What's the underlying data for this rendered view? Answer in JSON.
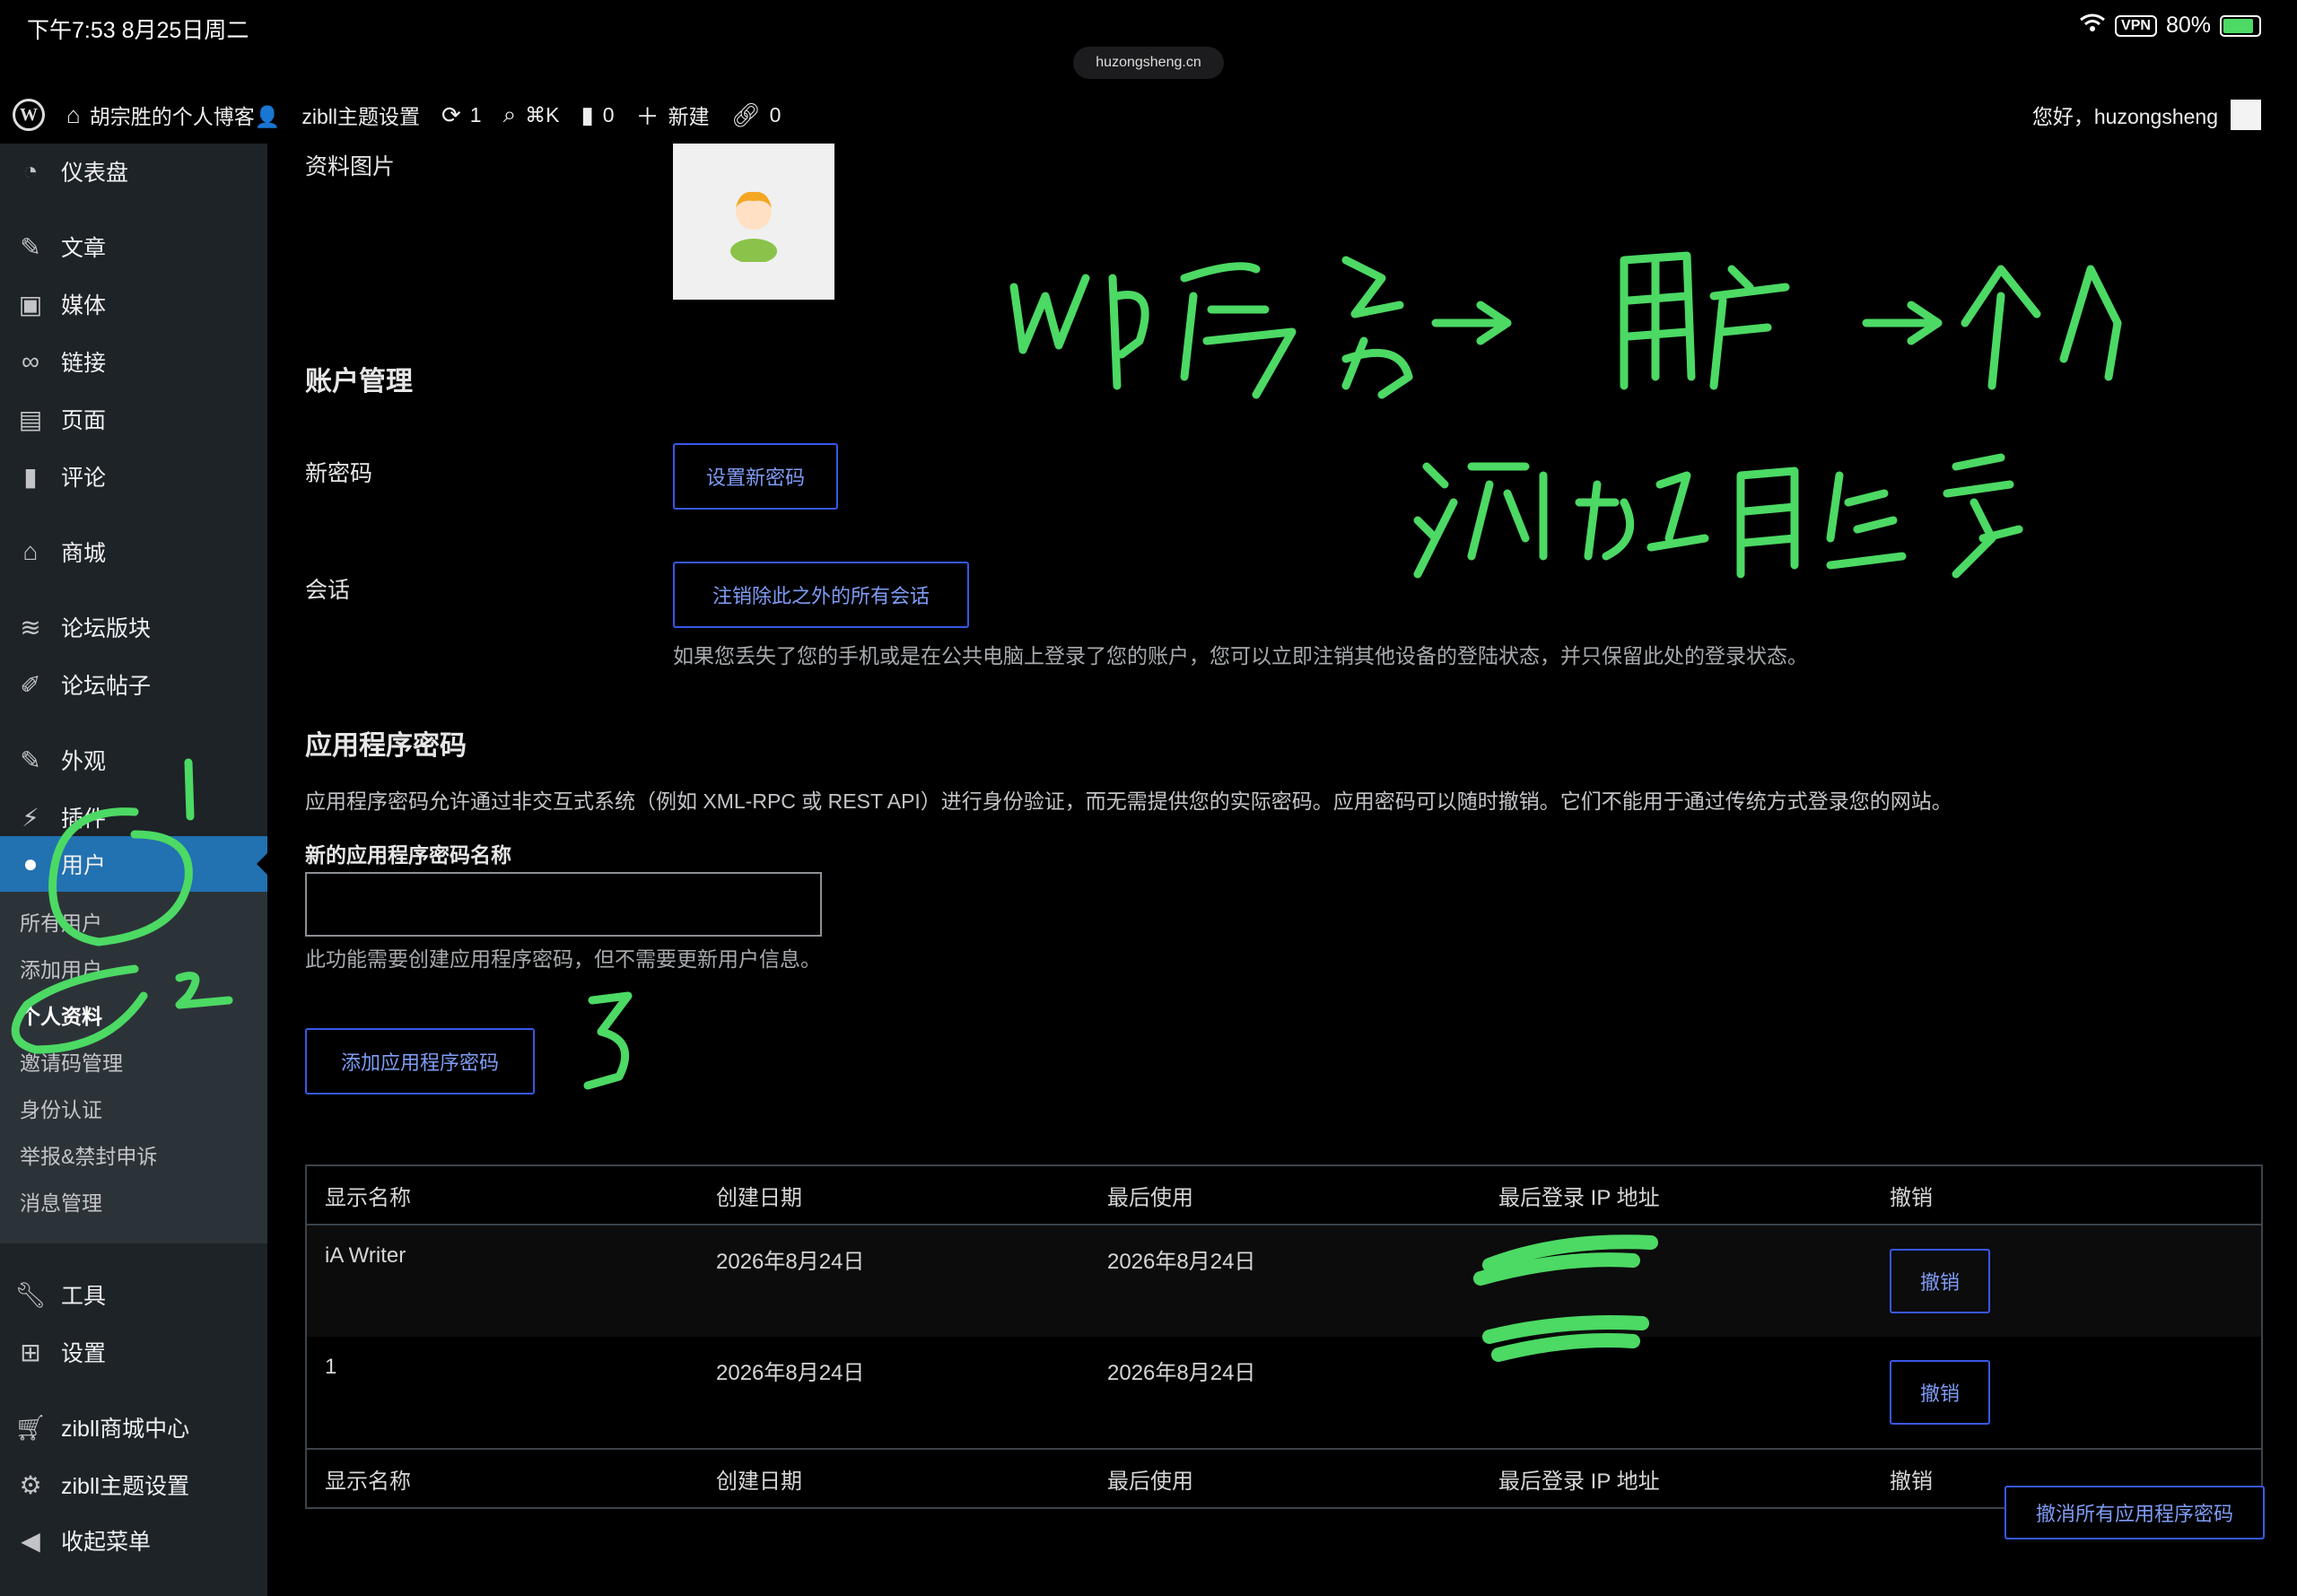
{
  "status": {
    "time": "下午7:53  8月25日周二",
    "vpn": "VPN",
    "battery": "80%",
    "url": "huzongsheng.cn"
  },
  "adminbar": {
    "site_name": "胡宗胜的个人博客👤",
    "theme_settings": "zibll主题设置",
    "updates": "1",
    "search_shortcut": "⌘K",
    "comments": "0",
    "new_label": "新建",
    "links": "0",
    "greeting": "您好，huzongsheng"
  },
  "sidebar": {
    "items": [
      {
        "label": "仪表盘",
        "icon": "dashboard-icon"
      },
      {
        "label": "文章",
        "icon": "pin-icon"
      },
      {
        "label": "媒体",
        "icon": "media-icon"
      },
      {
        "label": "链接",
        "icon": "link-icon"
      },
      {
        "label": "页面",
        "icon": "page-icon"
      },
      {
        "label": "评论",
        "icon": "comment-icon"
      },
      {
        "label": "商城",
        "icon": "store-icon"
      },
      {
        "label": "论坛版块",
        "icon": "forum-icon"
      },
      {
        "label": "论坛帖子",
        "icon": "forum-post-icon"
      },
      {
        "label": "外观",
        "icon": "brush-icon"
      },
      {
        "label": "插件",
        "icon": "plugin-icon"
      },
      {
        "label": "用户",
        "icon": "user-icon"
      },
      {
        "label": "工具",
        "icon": "wrench-icon"
      },
      {
        "label": "设置",
        "icon": "settings-icon"
      },
      {
        "label": "zibll商城中心",
        "icon": "cart-icon"
      },
      {
        "label": "zibll主题设置",
        "icon": "gear-icon"
      },
      {
        "label": "收起菜单",
        "icon": "collapse-icon"
      }
    ],
    "submenu": [
      "所有用户",
      "添加用户",
      "个人资料",
      "邀请码管理",
      "身份认证",
      "举报&禁封申诉",
      "消息管理"
    ]
  },
  "main": {
    "profile_picture_label": "资料图片",
    "account_heading": "账户管理",
    "new_password_label": "新密码",
    "set_password_button": "设置新密码",
    "sessions_label": "会话",
    "logout_others_button": "注销除此之外的所有会话",
    "sessions_desc": "如果您丢失了您的手机或是在公共电脑上登录了您的账户，您可以立即注销其他设备的登陆状态，并只保留此处的登录状态。",
    "app_pw_heading": "应用程序密码",
    "app_pw_desc": "应用程序密码允许通过非交互式系统（例如 XML-RPC 或 REST API）进行身份验证，而无需提供您的实际密码。应用密码可以随时撤销。它们不能用于通过传统方式登录您的网站。",
    "new_app_pw_label": "新的应用程序密码名称",
    "new_app_pw_value": "",
    "new_app_pw_desc": "此功能需要创建应用程序密码，但不需要更新用户信息。",
    "add_app_pw_button": "添加应用程序密码",
    "revoke_all_button": "撤消所有应用程序密码"
  },
  "table": {
    "columns": [
      "显示名称",
      "创建日期",
      "最后使用",
      "最后登录 IP 地址",
      "撤销"
    ],
    "rows": [
      {
        "name": "iA Writer",
        "created": "2026年8月24日",
        "last_used": "2026年8月24日",
        "ip": "",
        "revoke": "撤销"
      },
      {
        "name": "1",
        "created": "2026年8月24日",
        "last_used": "2026年8月24日",
        "ip": "",
        "revoke": "撤销"
      }
    ]
  },
  "annotations": {
    "ink_color": "#4cd964",
    "accent_color": "#2271b1",
    "button_color": "#3858e9"
  }
}
